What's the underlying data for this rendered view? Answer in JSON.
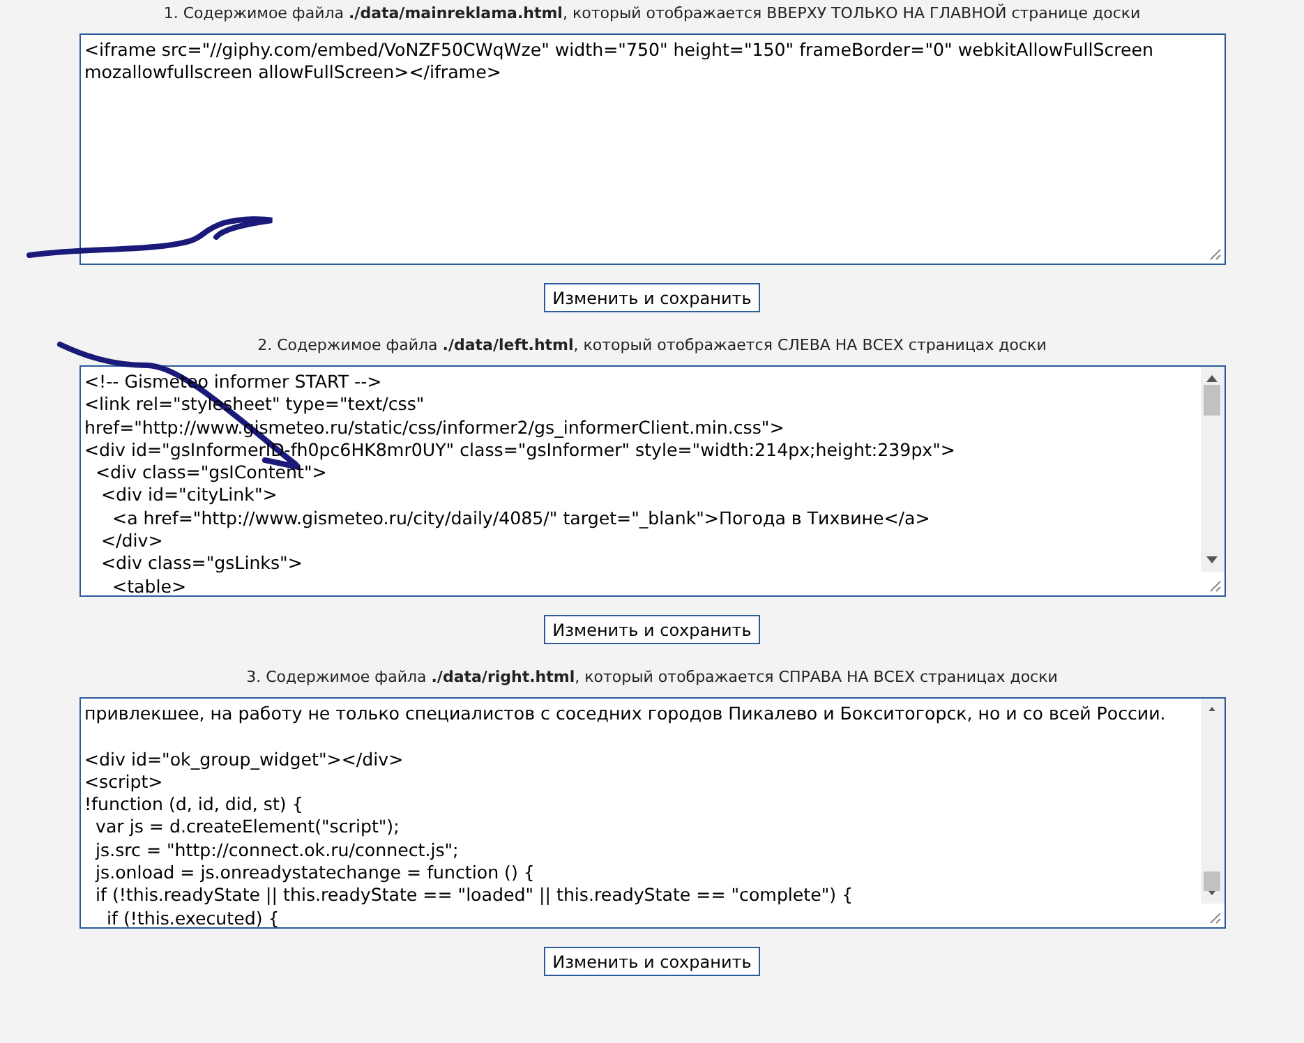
{
  "sections": [
    {
      "caption": "1. Содержимое файла **./data/mainreklama.html**, который отображается ВВЕРХУ ТОЛЬКО НА ГЛАВНОЙ странице доски",
      "kind": "plain",
      "blocks": [
        [
          "<iframe src=\"//giphy.com/embed/VoNZF50CWqWze\" width=\"750\" height=\"150\" frameBorder=\"0\" webkitAllowFullScreen",
          "mozallowfullscreen allowFullScreen></iframe>"
        ]
      ],
      "button": "Изменить и сохранить"
    },
    {
      "caption": "2. Содержимое файла **./data/left.html**, который отображается СЛЕВА НА ВСЕХ страницах доски",
      "kind": "scrolled",
      "blocks": [
        [
          "<!-- Gismeteo informer START -->",
          "<link rel=\"stylesheet\" type=\"text/css\"",
          "href=\"http://www.gismeteo.ru/static/css/informer2/gs_informerClient.min.css\">",
          "<div id=\"gsInformerID-fh0pc6HK8mr0UY\" class=\"gsInformer\" style=\"width:214px;height:239px\">",
          "  <div class=\"gsIContent\">",
          "   <div id=\"cityLink\">",
          "     <a href=\"http://www.gismeteo.ru/city/daily/4085/\" target=\"_blank\">Погода в Тихвине</a>",
          "   </div>",
          "   <div class=\"gsLinks\">",
          "     <table>"
        ]
      ],
      "button": "Изменить и сохранить"
    },
    {
      "caption": "3. Содержимое файла **./data/right.html**, который отображается СПРАВА НА ВСЕХ страницах доски",
      "kind": "scrolled",
      "blocks": [
        [
          "привлекшее, на работу не только специалистов с соседних городов Пикалево и Бокситогорск, но и со всей России."
        ],
        [
          "<div id=\"ok_group_widget\"></div>",
          "<script>",
          "!function (d, id, did, st) {",
          "  var js = d.createElement(\"script\");",
          "  js.src = \"http://connect.ok.ru/connect.js\";",
          "  js.onload = js.onreadystatechange = function () {",
          "  if (!this.readyState || this.readyState == \"loaded\" || this.readyState == \"complete\") {",
          "    if (!this.executed) {"
        ]
      ],
      "button": "Изменить и сохранить"
    }
  ]
}
